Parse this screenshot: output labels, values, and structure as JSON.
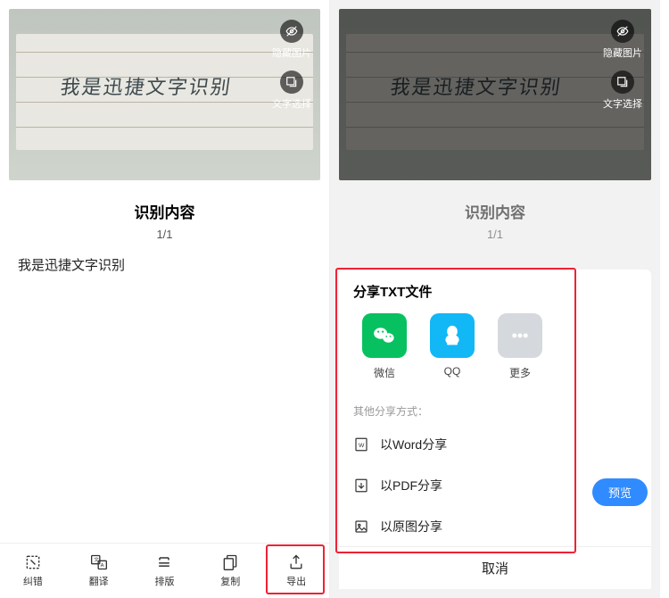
{
  "handwriting_text": "我是迅捷文字识别",
  "section_title": "识别内容",
  "page_count": "1/1",
  "recognized": "我是迅捷文字识别",
  "overlay": {
    "hide_label": "隐藏图片",
    "select_label": "文字选择"
  },
  "tabs": {
    "correct": "纠错",
    "translate": "翻译",
    "layout": "排版",
    "copy": "复制",
    "export": "导出"
  },
  "share": {
    "title": "分享TXT文件",
    "wechat": "微信",
    "qq": "QQ",
    "more": "更多",
    "other_title": "其他分享方式：",
    "word": "以Word分享",
    "pdf": "以PDF分享",
    "image": "以原图分享",
    "cancel": "取消",
    "preview": "预览"
  }
}
